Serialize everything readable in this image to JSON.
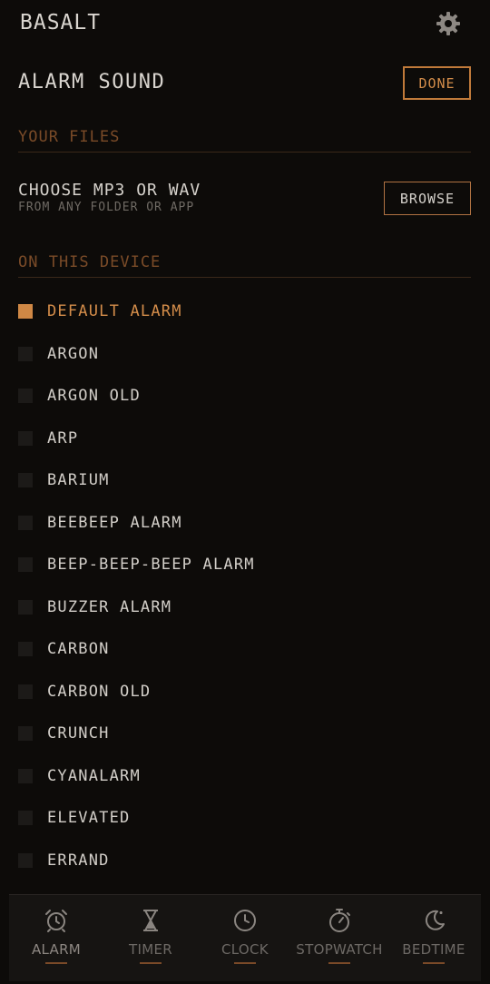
{
  "app": {
    "title": "BASALT",
    "settings_icon": "gear-icon"
  },
  "header": {
    "title": "ALARM SOUND",
    "done_label": "DONE"
  },
  "your_files": {
    "heading": "YOUR FILES",
    "choose_title": "CHOOSE MP3 OR WAV",
    "choose_subtitle": "FROM ANY FOLDER OR APP",
    "browse_label": "BROWSE"
  },
  "device": {
    "heading": "ON THIS DEVICE",
    "sounds": [
      {
        "label": "DEFAULT ALARM",
        "selected": true
      },
      {
        "label": "ARGON",
        "selected": false
      },
      {
        "label": "ARGON OLD",
        "selected": false
      },
      {
        "label": "ARP",
        "selected": false
      },
      {
        "label": "BARIUM",
        "selected": false
      },
      {
        "label": "BEEBEEP ALARM",
        "selected": false
      },
      {
        "label": "BEEP-BEEP-BEEP ALARM",
        "selected": false
      },
      {
        "label": "BUZZER ALARM",
        "selected": false
      },
      {
        "label": "CARBON",
        "selected": false
      },
      {
        "label": "CARBON OLD",
        "selected": false
      },
      {
        "label": "CRUNCH",
        "selected": false
      },
      {
        "label": "CYANALARM",
        "selected": false
      },
      {
        "label": "ELEVATED",
        "selected": false
      },
      {
        "label": "ERRAND",
        "selected": false
      }
    ]
  },
  "bottom_nav": {
    "items": [
      {
        "label": "ALARM",
        "icon": "alarm-clock-icon",
        "active": true
      },
      {
        "label": "TIMER",
        "icon": "hourglass-icon",
        "active": false
      },
      {
        "label": "CLOCK",
        "icon": "clock-icon",
        "active": false
      },
      {
        "label": "STOPWATCH",
        "icon": "stopwatch-icon",
        "active": false
      },
      {
        "label": "BEDTIME",
        "icon": "moon-icon",
        "active": false
      }
    ]
  },
  "colors": {
    "background": "#0d0b09",
    "accent": "#cf8845",
    "section_heading": "#7a4b28",
    "text": "#d6d2cc",
    "muted": "#6f6a64"
  }
}
